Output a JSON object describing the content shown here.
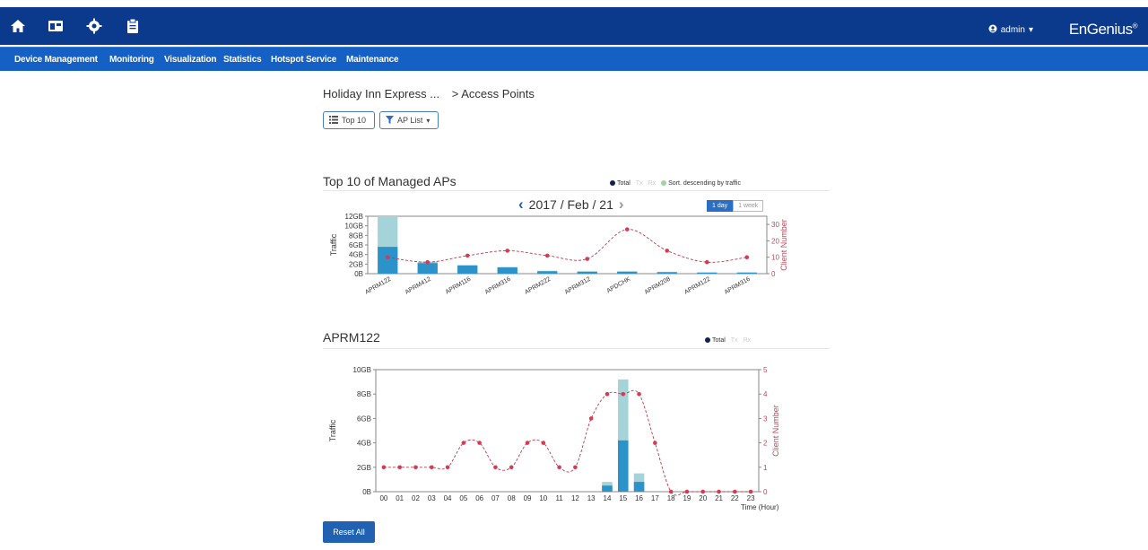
{
  "header": {
    "icons": [
      "home-icon",
      "dashboard-icon",
      "gear-icon",
      "clipboard-icon"
    ],
    "user": "admin",
    "brand": "EnGenius",
    "brand_mark": "®"
  },
  "nav": {
    "items": [
      "Device Management",
      "Monitoring",
      "Visualization",
      "Statistics",
      "Hotspot Service",
      "Maintenance"
    ]
  },
  "breadcrumb": {
    "site": "Holiday Inn Express ...",
    "sep": ">",
    "page": "Access Points"
  },
  "controls": {
    "top_button": "Top 10",
    "filter_button": "AP List"
  },
  "top_section": {
    "title": "Top 10 of Managed APs",
    "legend": {
      "total": "Total",
      "tx": "Tx",
      "rx": "Rx",
      "sort": "Sort. descending by traffic"
    },
    "date": "2017 / Feb / 21",
    "toggle": {
      "day": "1 day",
      "week": "1 week"
    }
  },
  "ap_section": {
    "title": "APRM122",
    "legend": {
      "total": "Total",
      "tx": "Tx",
      "rx": "Rx"
    }
  },
  "reset_label": "Reset All",
  "colors": {
    "topbar": "#0b3a8c",
    "navbar": "#1560c4",
    "bar_total": "#a4d3da",
    "bar_primary": "#2b93c9",
    "line": "#b93a4e",
    "axis_right": "#b84a5b"
  },
  "chart_data": [
    {
      "type": "bar",
      "title": "Top 10 of Managed APs",
      "categories": [
        "APRM122",
        "APRM412",
        "APRM116",
        "APRM316",
        "APRM222",
        "APRM312",
        "APDCHK",
        "APRM208",
        "APRM122",
        "APRM316"
      ],
      "series": [
        {
          "name": "Total",
          "values": [
            12,
            2.5,
            1.8,
            1.4,
            0.6,
            0.5,
            0.5,
            0.4,
            0.3,
            0.3
          ]
        },
        {
          "name": "Tx",
          "values": [
            5.6,
            2.2,
            1.7,
            1.3,
            0.5,
            0.4,
            0.4,
            0.3,
            0.2,
            0.2
          ]
        },
        {
          "name": "Client Number",
          "values": [
            10,
            7,
            11,
            14,
            11,
            9,
            27,
            14,
            7,
            10
          ]
        }
      ],
      "ylabel": "Traffic",
      "y2label": "Client Number",
      "y_ticks": [
        "0B",
        "2GB",
        "4GB",
        "6GB",
        "8GB",
        "10GB",
        "12GB"
      ],
      "ylim": [
        0,
        12
      ],
      "y2_ticks": [
        "0",
        "10",
        "20",
        "30"
      ],
      "y2lim": [
        0,
        35
      ]
    },
    {
      "type": "bar",
      "title": "APRM122",
      "categories": [
        "00",
        "01",
        "02",
        "03",
        "04",
        "05",
        "06",
        "07",
        "08",
        "09",
        "10",
        "11",
        "12",
        "13",
        "14",
        "15",
        "16",
        "17",
        "18",
        "19",
        "20",
        "21",
        "22",
        "23"
      ],
      "series": [
        {
          "name": "Total",
          "values": [
            0,
            0,
            0,
            0,
            0,
            0,
            0,
            0,
            0,
            0,
            0,
            0,
            0,
            0,
            0.8,
            9.2,
            1.5,
            0,
            0,
            0,
            0,
            0,
            0,
            0
          ]
        },
        {
          "name": "Tx",
          "values": [
            0,
            0,
            0,
            0,
            0,
            0,
            0,
            0,
            0,
            0,
            0,
            0,
            0,
            0,
            0.5,
            4.2,
            0.8,
            0,
            0,
            0,
            0,
            0,
            0,
            0
          ]
        },
        {
          "name": "Client Number",
          "values": [
            1,
            1,
            1,
            1,
            1,
            2,
            2,
            1,
            1,
            2,
            2,
            1,
            1,
            3,
            4,
            4,
            4,
            2,
            0,
            0,
            0,
            0,
            0,
            0
          ]
        }
      ],
      "xlabel": "Time (Hour)",
      "ylabel": "Traffic",
      "y2label": "Client Number",
      "y_ticks": [
        "0B",
        "2GB",
        "4GB",
        "6GB",
        "8GB",
        "10GB"
      ],
      "ylim": [
        0,
        10
      ],
      "y2_ticks": [
        "0",
        "1",
        "2",
        "3",
        "4",
        "5"
      ],
      "y2lim": [
        0,
        5
      ]
    }
  ]
}
